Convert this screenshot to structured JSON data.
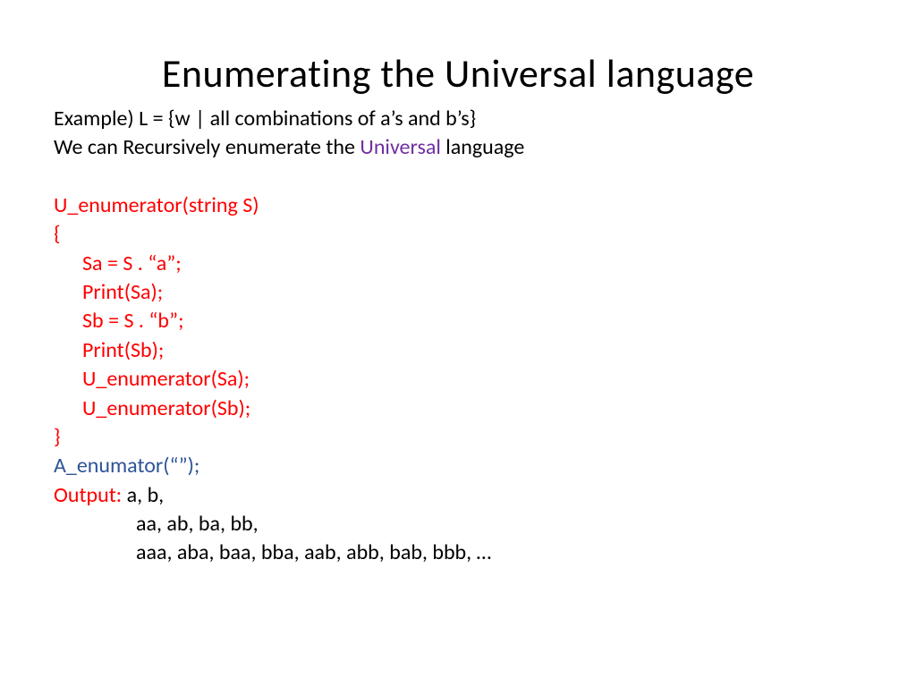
{
  "title": "Enumerating the Universal language",
  "intro": {
    "line1": "Example) L = {w | all combinations of a’s and b’s}",
    "line2_a": "We can Recursively enumerate the ",
    "line2_b": "Universal",
    "line2_c": " language"
  },
  "code": {
    "l1": "U_enumerator(string S)",
    "l2": "{",
    "l3": "Sa = S . “a”;",
    "l4": "Print(Sa);",
    "l5": "Sb = S . “b”;",
    "l6": "Print(Sb);",
    "l7": "U_enumerator(Sa);",
    "l8": "U_enumerator(Sb);",
    "l9": "}"
  },
  "call": "A_enumator(“”);",
  "output": {
    "label": "Output: ",
    "l1": "a, b,",
    "l2": "aa, ab, ba, bb,",
    "l3": "aaa, aba, baa, bba, aab, abb, bab, bbb, …"
  }
}
